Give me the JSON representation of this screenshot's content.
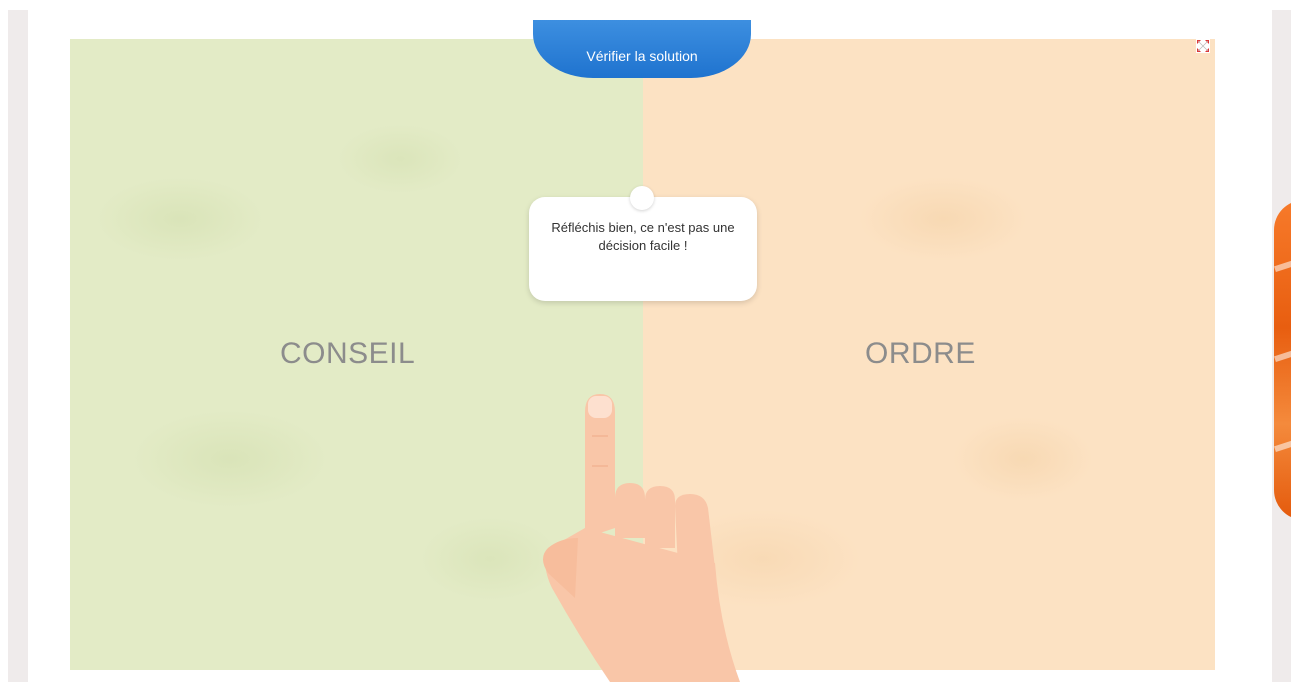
{
  "toolbar": {
    "verify_label": "Vérifier la solution",
    "fullscreen_icon": "fullscreen-icon"
  },
  "tooltip": {
    "text": "Réfléchis bien, ce n'est pas une décision facile !"
  },
  "zones": {
    "left": {
      "label": "CONSEIL",
      "color": "#e3ebc6"
    },
    "right": {
      "label": "ORDRE",
      "color": "#fce2c3"
    }
  },
  "colors": {
    "accent": "#2a7fd8",
    "hand": "#f9c6a8",
    "deco_orange": "#ef6a1a"
  }
}
